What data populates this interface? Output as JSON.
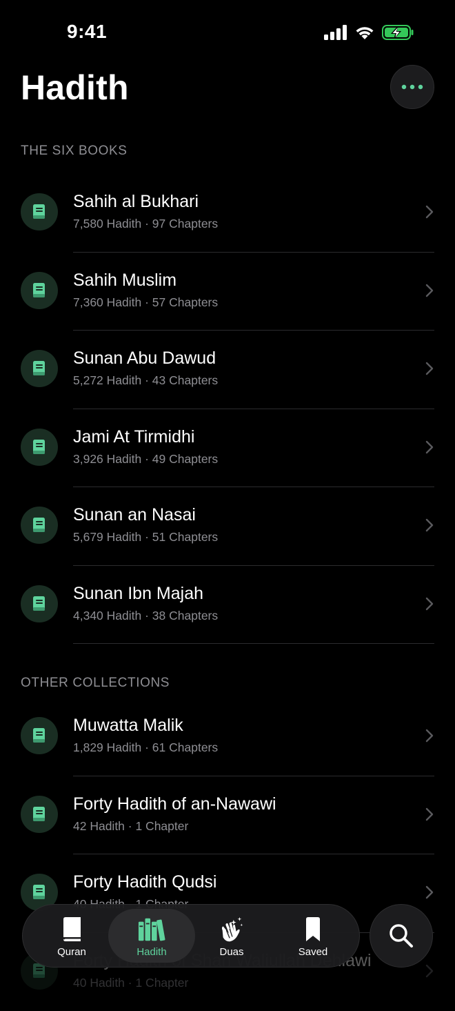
{
  "status_bar": {
    "time": "9:41"
  },
  "header": {
    "title": "Hadith"
  },
  "colors": {
    "accent": "#5fd39d",
    "icon_bg": "#1a2e23",
    "background": "#000000",
    "secondary_text": "#8e8e93",
    "battery": "#34c759"
  },
  "sections": [
    {
      "header": "THE SIX BOOKS",
      "items": [
        {
          "title": "Sahih al Bukhari",
          "subtitle": "7,580 Hadith · 97 Chapters",
          "icon": "book-icon"
        },
        {
          "title": "Sahih Muslim",
          "subtitle": "7,360 Hadith · 57 Chapters",
          "icon": "book-icon"
        },
        {
          "title": "Sunan Abu Dawud",
          "subtitle": "5,272 Hadith · 43 Chapters",
          "icon": "book-icon"
        },
        {
          "title": "Jami At Tirmidhi",
          "subtitle": "3,926 Hadith · 49 Chapters",
          "icon": "book-icon"
        },
        {
          "title": "Sunan an Nasai",
          "subtitle": "5,679 Hadith · 51 Chapters",
          "icon": "book-icon"
        },
        {
          "title": "Sunan Ibn Majah",
          "subtitle": "4,340 Hadith · 38 Chapters",
          "icon": "book-icon"
        }
      ]
    },
    {
      "header": "OTHER COLLECTIONS",
      "items": [
        {
          "title": "Muwatta Malik",
          "subtitle": "1,829 Hadith · 61 Chapters",
          "icon": "book-icon"
        },
        {
          "title": "Forty Hadith of an-Nawawi",
          "subtitle": "42 Hadith · 1 Chapter",
          "icon": "book-icon"
        },
        {
          "title": "Forty Hadith Qudsi",
          "subtitle": "40 Hadith · 1 Chapter",
          "icon": "book-icon"
        },
        {
          "title": "Forty Hadith of Shah Waliullah Dehlawi",
          "subtitle": "40 Hadith · 1 Chapter",
          "icon": "book-icon"
        }
      ]
    }
  ],
  "tab_bar": {
    "tabs": [
      {
        "label": "Quran",
        "icon": "book-closed-icon",
        "active": false
      },
      {
        "label": "Hadith",
        "icon": "books-icon",
        "active": true
      },
      {
        "label": "Duas",
        "icon": "praying-hands-icon",
        "active": false
      },
      {
        "label": "Saved",
        "icon": "bookmark-icon",
        "active": false
      }
    ]
  },
  "search": {
    "icon": "search-icon"
  }
}
